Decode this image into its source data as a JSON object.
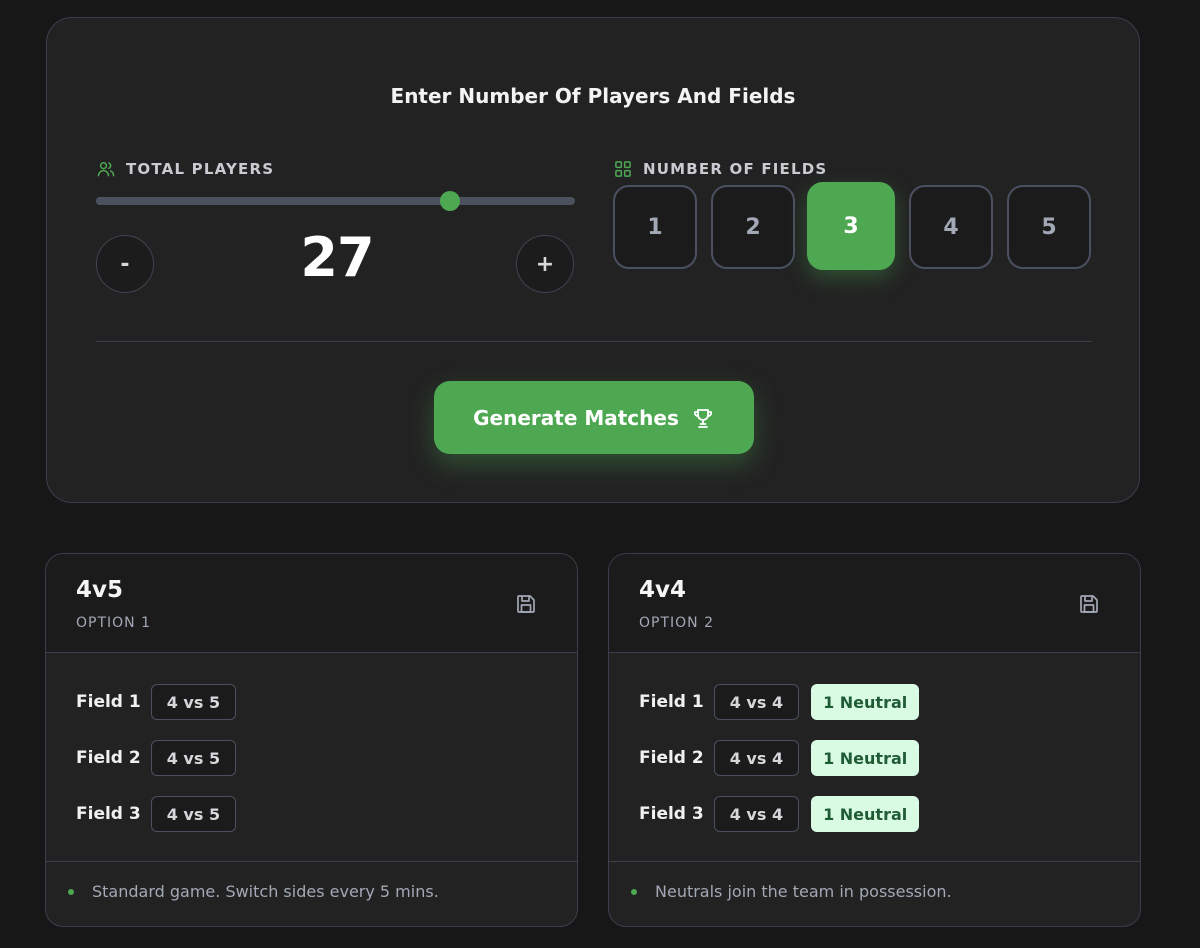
{
  "config": {
    "title": "Enter Number Of Players And Fields",
    "players_label": "TOTAL PLAYERS",
    "fields_label": "NUMBER OF FIELDS",
    "players": {
      "value": "27",
      "slider_fraction": 0.74,
      "minus": "-",
      "plus": "+"
    },
    "fields": [
      "1",
      "2",
      "3",
      "4",
      "5"
    ],
    "selected_field": "3",
    "generate_label": "Generate Matches"
  },
  "options": [
    {
      "title": "4v5",
      "subtitle": "OPTION 1",
      "rows": [
        {
          "field": "Field 1",
          "vs": "4 vs 5"
        },
        {
          "field": "Field 2",
          "vs": "4 vs 5"
        },
        {
          "field": "Field 3",
          "vs": "4 vs 5"
        }
      ],
      "note": "Standard game. Switch sides every 5 mins."
    },
    {
      "title": "4v4",
      "subtitle": "OPTION 2",
      "rows": [
        {
          "field": "Field 1",
          "vs": "4 vs 4",
          "neutral": "1 Neutral"
        },
        {
          "field": "Field 2",
          "vs": "4 vs 4",
          "neutral": "1 Neutral"
        },
        {
          "field": "Field 3",
          "vs": "4 vs 4",
          "neutral": "1 Neutral"
        }
      ],
      "note": "Neutrals join the team in possession."
    }
  ],
  "colors": {
    "accent": "#4ea852",
    "neutral_bg": "#d9fbe3",
    "card_bg": "#222222",
    "page_bg": "#171717"
  },
  "icons": {
    "players": "users-icon",
    "fields": "grid-icon",
    "generate": "trophy-icon",
    "save": "save-icon"
  }
}
